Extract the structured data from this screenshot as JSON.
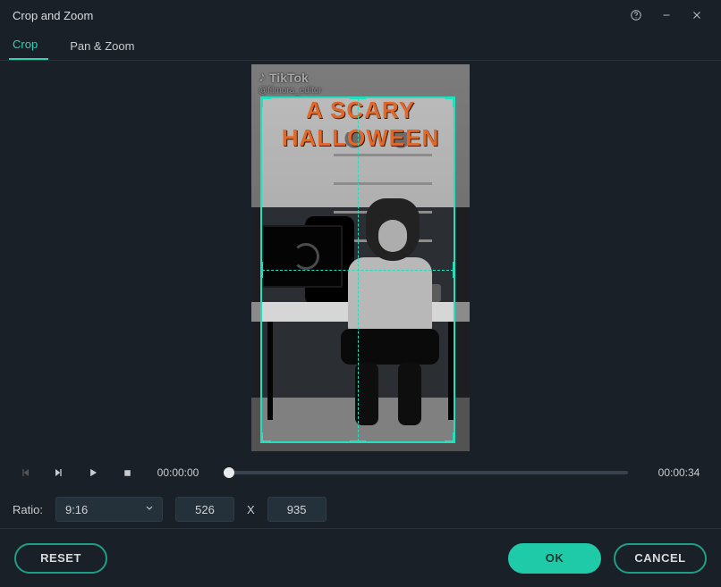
{
  "window": {
    "title": "Crop and Zoom"
  },
  "tabs": [
    {
      "label": "Crop",
      "active": true
    },
    {
      "label": "Pan & Zoom",
      "active": false
    }
  ],
  "preview": {
    "platform_label": "TikTok",
    "handle": "@filmora_editor",
    "headline_line1": "A SCARY",
    "headline_line2": "HALLOWEEN"
  },
  "playback": {
    "current_time": "00:00:00",
    "duration": "00:00:34",
    "progress_pct": 0
  },
  "params": {
    "ratio_label": "Ratio:",
    "ratio_value": "9:16",
    "width": "526",
    "sep": "X",
    "height": "935"
  },
  "buttons": {
    "reset": "RESET",
    "ok": "OK",
    "cancel": "CANCEL"
  },
  "icons": {
    "help": "help-circle-icon",
    "minimize": "minimize-icon",
    "close": "close-icon",
    "prev_frame": "prev-frame-icon",
    "next_frame": "next-frame-icon",
    "play": "play-icon",
    "stop": "stop-icon",
    "chevron": "chevron-down-icon",
    "tiktok": "tiktok-icon"
  }
}
